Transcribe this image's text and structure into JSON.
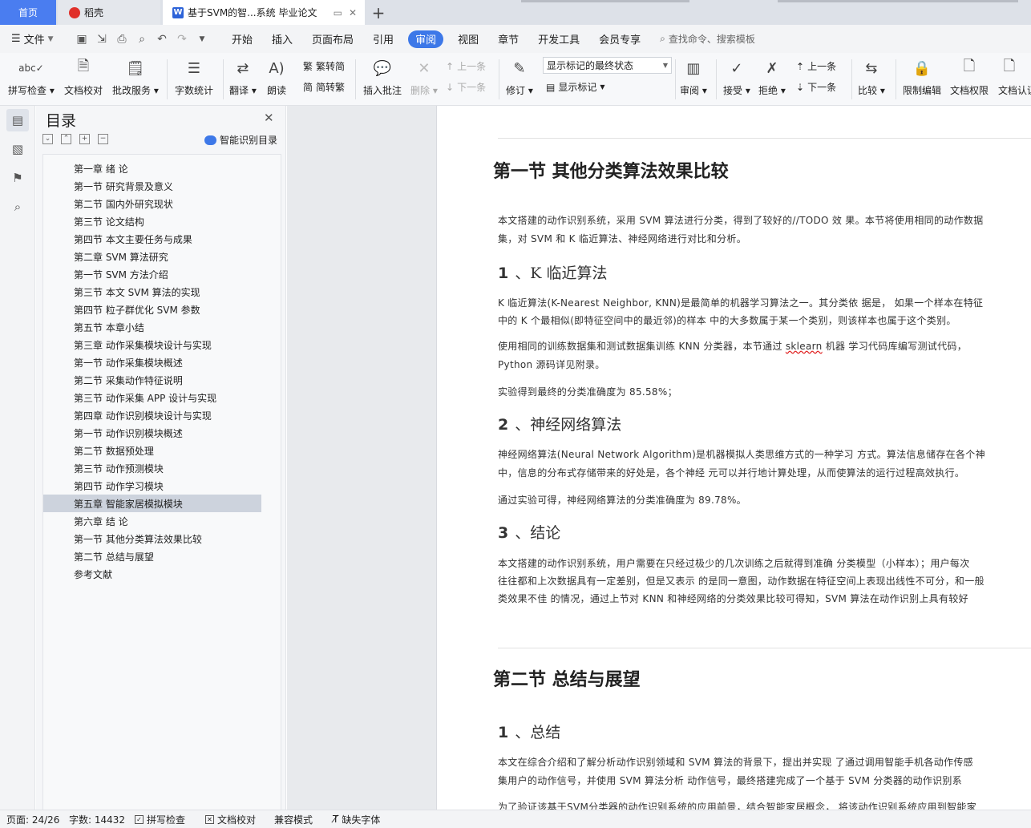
{
  "tabs": {
    "home": "首页",
    "daoke": "稻壳",
    "document": "基于SVM的智...系统 毕业论文"
  },
  "menu": {
    "file": "文件",
    "items": [
      "开始",
      "插入",
      "页面布局",
      "引用",
      "审阅",
      "视图",
      "章节",
      "开发工具",
      "会员专享"
    ],
    "active": "审阅",
    "search_placeholder": "查找命令、搜索模板"
  },
  "ribbon": {
    "spell_check": "拼写检查",
    "doc_proof": "文档校对",
    "annotation_service": "批改服务",
    "word_count": "字数统计",
    "translate": "翻译",
    "read_aloud": "朗读",
    "trad_to_simp": "繁转简",
    "simp_to_trad": "简转繁",
    "insert_comment": "插入批注",
    "delete": "删除",
    "prev_comment": "上一条",
    "next_comment": "下一条",
    "track_changes": "修订",
    "markup_state": "显示标记的最终状态",
    "show_markup": "显示标记",
    "review": "审阅",
    "accept": "接受",
    "reject": "拒绝",
    "prev_change": "上一条",
    "next_change": "下一条",
    "compare": "比较",
    "restrict_edit": "限制编辑",
    "doc_permission": "文档权限",
    "doc_cert": "文档认证"
  },
  "toc": {
    "title": "目录",
    "smart_toc": "智能识别目录",
    "items": [
      "第一章 绪 论",
      "第一节 研究背景及意义",
      "第二节 国内外研究现状",
      "第三节 论文结构",
      "第四节 本文主要任务与成果",
      "第二章 SVM 算法研究",
      "第一节 SVM 方法介绍",
      "第三节 本文 SVM 算法的实现",
      "第四节 粒子群优化 SVM 参数",
      "第五节 本章小结",
      "第三章 动作采集模块设计与实现",
      "第一节 动作采集模块概述",
      "第二节 采集动作特征说明",
      "第三节 动作采集 APP 设计与实现",
      "第四章 动作识别模块设计与实现",
      "第一节 动作识别模块概述",
      "第二节 数据预处理",
      "第三节 动作预测模块",
      "第四节 动作学习模块",
      "第五章 智能家居模拟模块",
      "第六章 结 论",
      "第一节 其他分类算法效果比较",
      "第二节 总结与展望",
      "参考文献"
    ],
    "active_index": 19
  },
  "document": {
    "section1_title": "第一节 其他分类算法效果比较",
    "s1_intro_1": "本文搭建的动作识别系统，采用 SVM 算法进行分类，得到了较好的//TODO 效 果。本节将使用相同的动作数据",
    "s1_intro_2": "集，对 SVM 和 K 临近算法、神经网络进行对比和分析。",
    "h1_num": "1",
    "h1_title": "、K 临近算法",
    "knn_p1_1": "K 临近算法(K-Nearest Neighbor, KNN)是最简单的机器学习算法之一。其分类依 据是， 如果一个样本在特征",
    "knn_p1_2": "中的 K 个最相似(即特征空间中的最近邻)的样本 中的大多数属于某一个类别，则该样本也属于这个类别。",
    "knn_p2_1a": "使用相同的训练数据集和测试数据集训练 KNN 分类器，本节通过 ",
    "knn_p2_1b": "sklearn",
    "knn_p2_1c": " 机器 学习代码库编写测试代码，",
    "knn_p2_2": "Python 源码详见附录。",
    "knn_p3": "实验得到最终的分类准确度为 85.58%；",
    "h2_num": "2",
    "h2_title": "、神经网络算法",
    "nn_p1_1": "神经网络算法(Neural Network Algorithm)是机器模拟人类思维方式的一种学习 方式。算法信息储存在各个神",
    "nn_p1_2": "中，信息的分布式存储带来的好处是，各个神经 元可以并行地计算处理，从而使算法的运行过程高效执行。",
    "nn_p2": "通过实验可得，神经网络算法的分类准确度为 89.78%。",
    "h3_num": "3",
    "h3_title": "、结论",
    "con_1": "本文搭建的动作识别系统，用户需要在只经过极少的几次训练之后就得到准确 分类模型（小样本）；用户每次",
    "con_2": "往往都和上次数据具有一定差别，但是又表示 的是同一意图，动作数据在特征空间上表现出线性不可分，和一般",
    "con_3": "类效果不佳 的情况，通过上节对 KNN 和神经网络的分类效果比较可得知，SVM 算法在动作识别上具有较好",
    "section2_title": "第二节 总结与展望",
    "h4_num": "1",
    "h4_title": "、总结",
    "sum_1": "本文在综合介绍和了解分析动作识别领域和 SVM 算法的背景下，提出并实现 了通过调用智能手机各动作传感",
    "sum_2": "集用户的动作信号，并使用 SVM 算法分析 动作信号，最终搭建完成了一个基于 SVM 分类器的动作识别系",
    "sum_3": "为了验证该基于SVM分类器的动作识别系统的应用前景，结合智能家居概念， 将该动作识别系统应用到智能家"
  },
  "status": {
    "page": "页面: 24/26",
    "words": "字数: 14432",
    "spell_check": "拼写检查",
    "doc_proof": "文档校对",
    "compat_mode": "兼容模式",
    "missing_fonts": "缺失字体"
  },
  "colors": {
    "accent": "#3d78e8",
    "toc_active": "#cdd3dd",
    "canvas_bg": "#e8eaed"
  }
}
